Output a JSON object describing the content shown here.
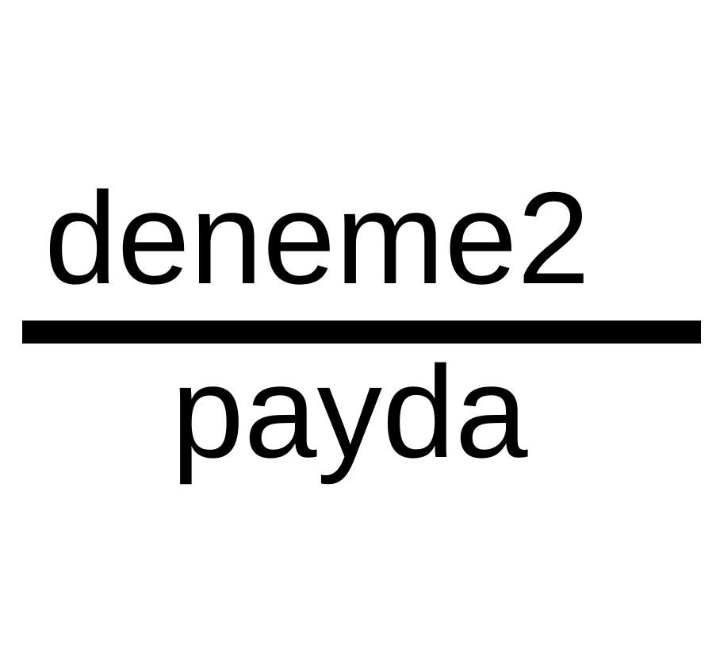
{
  "fraction": {
    "numerator": "deneme2",
    "denominator": "payda"
  },
  "colors": {
    "background": "#ffffff",
    "text": "#000000",
    "bar": "#000000"
  }
}
